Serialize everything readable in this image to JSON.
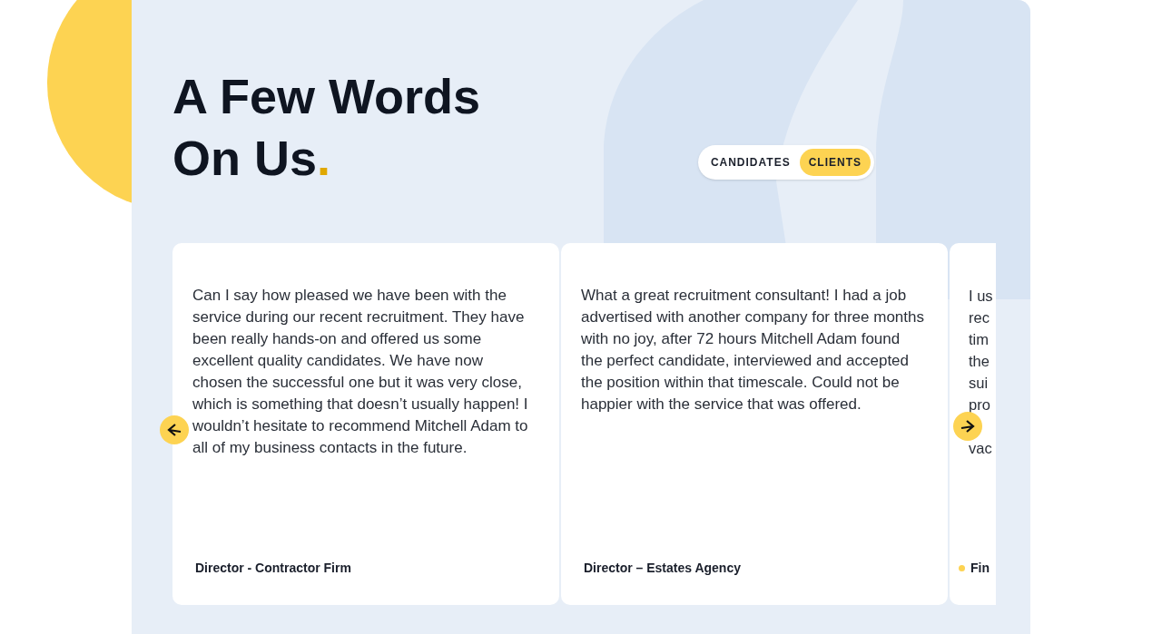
{
  "heading": {
    "lines": [
      "A Few Words",
      "On Us"
    ],
    "accent": "."
  },
  "tabs": [
    {
      "label": "CANDIDATES",
      "selected": false
    },
    {
      "label": "CLIENTS",
      "selected": true
    }
  ],
  "testimonials": [
    {
      "text": "Can I say how pleased we have been with the service during our recent recruitment. They have been really hands-on and offered us some excellent quality candidates. We have now chosen the successful one but it was very close, which is something that doesn’t usually happen! I wouldn’t hesitate to recommend Mitchell Adam to all of my business contacts in the future.",
      "author": "Director - Contractor Firm"
    },
    {
      "text": "What a great recruitment consultant! I had a job advertised with another company for three months with no joy, after 72 hours Mitchell Adam found the perfect candidate, interviewed and accepted the position within that timescale. Could not be happier with the service that was offered.",
      "author": "Director – Estates Agency"
    }
  ],
  "partial_testimonial": {
    "lines_above_button": [
      "I us",
      "rec",
      "tim",
      "the",
      "sui",
      "pro"
    ],
    "lines_below_button": [
      "vac"
    ],
    "author": "Fin"
  }
}
